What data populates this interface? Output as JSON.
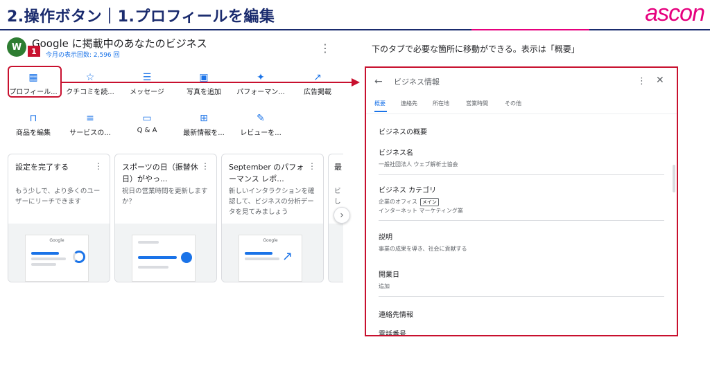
{
  "header": {
    "title": "2.操作ボタン｜1.プロフィールを編集",
    "brand": "ascon"
  },
  "left": {
    "logo_text": "W",
    "business_title": "Google に掲載中のあなたのビジネス",
    "views_label": "今月の表示回数: 2,596 回",
    "step_number": "1",
    "actions_row1": [
      {
        "icon": "store-icon",
        "label": "プロフィール..."
      },
      {
        "icon": "review-icon",
        "label": "クチコミを読..."
      },
      {
        "icon": "message-icon",
        "label": "メッセージ"
      },
      {
        "icon": "photo-icon",
        "label": "写真を追加"
      },
      {
        "icon": "performance-icon",
        "label": "パフォーマン..."
      },
      {
        "icon": "trend-icon",
        "label": "広告掲載"
      }
    ],
    "actions_row2": [
      {
        "icon": "bag-icon",
        "label": "商品を編集"
      },
      {
        "icon": "list-icon",
        "label": "サービスの..."
      },
      {
        "icon": "qa-icon",
        "label": "Q & A"
      },
      {
        "icon": "post-icon",
        "label": "最新情報を..."
      },
      {
        "icon": "review-request-icon",
        "label": "レビューを..."
      }
    ],
    "cards": [
      {
        "title": "設定を完了する",
        "body": "もう少しで、より多くのユーザーにリーチできます",
        "illus_label": "Google"
      },
      {
        "title": "スポーツの日（振替休日）がやっ...",
        "body": "祝日の営業時間を更新しますか？",
        "illus_label": ""
      },
      {
        "title": "September のパフォーマンス レポ...",
        "body": "新しいインタラクションを確認して、ビジネスの分析データを見てみましょう",
        "illus_label": "Google"
      },
      {
        "title": "最",
        "body": "ビ し",
        "illus_label": ""
      }
    ]
  },
  "right": {
    "instruction": "下のタブで必要な箇所に移動ができる。表示は「概要」",
    "panel_title": "ビジネス情報",
    "tabs": [
      "概要",
      "連絡先",
      "所在地",
      "営業時間",
      "その他"
    ],
    "section_overview": "ビジネスの概要",
    "name_label": "ビジネス名",
    "name_value": "一般社団法人 ウェブ解析士協会",
    "category_label": "ビジネス カテゴリ",
    "category_primary": "企業のオフィス",
    "category_primary_badge": "メイン",
    "category_secondary": "インターネット マーケティング業",
    "description_label": "説明",
    "description_value": "事業の成果を導き、社会に貢献する",
    "opening_label": "開業日",
    "opening_value": "追加",
    "section_contact": "連絡先情報",
    "phone_label": "電話番号"
  },
  "colors": {
    "accent_red": "#c8102e",
    "brand_pink": "#e6007e",
    "title_navy": "#1a2b6e",
    "google_blue": "#1a73e8"
  }
}
